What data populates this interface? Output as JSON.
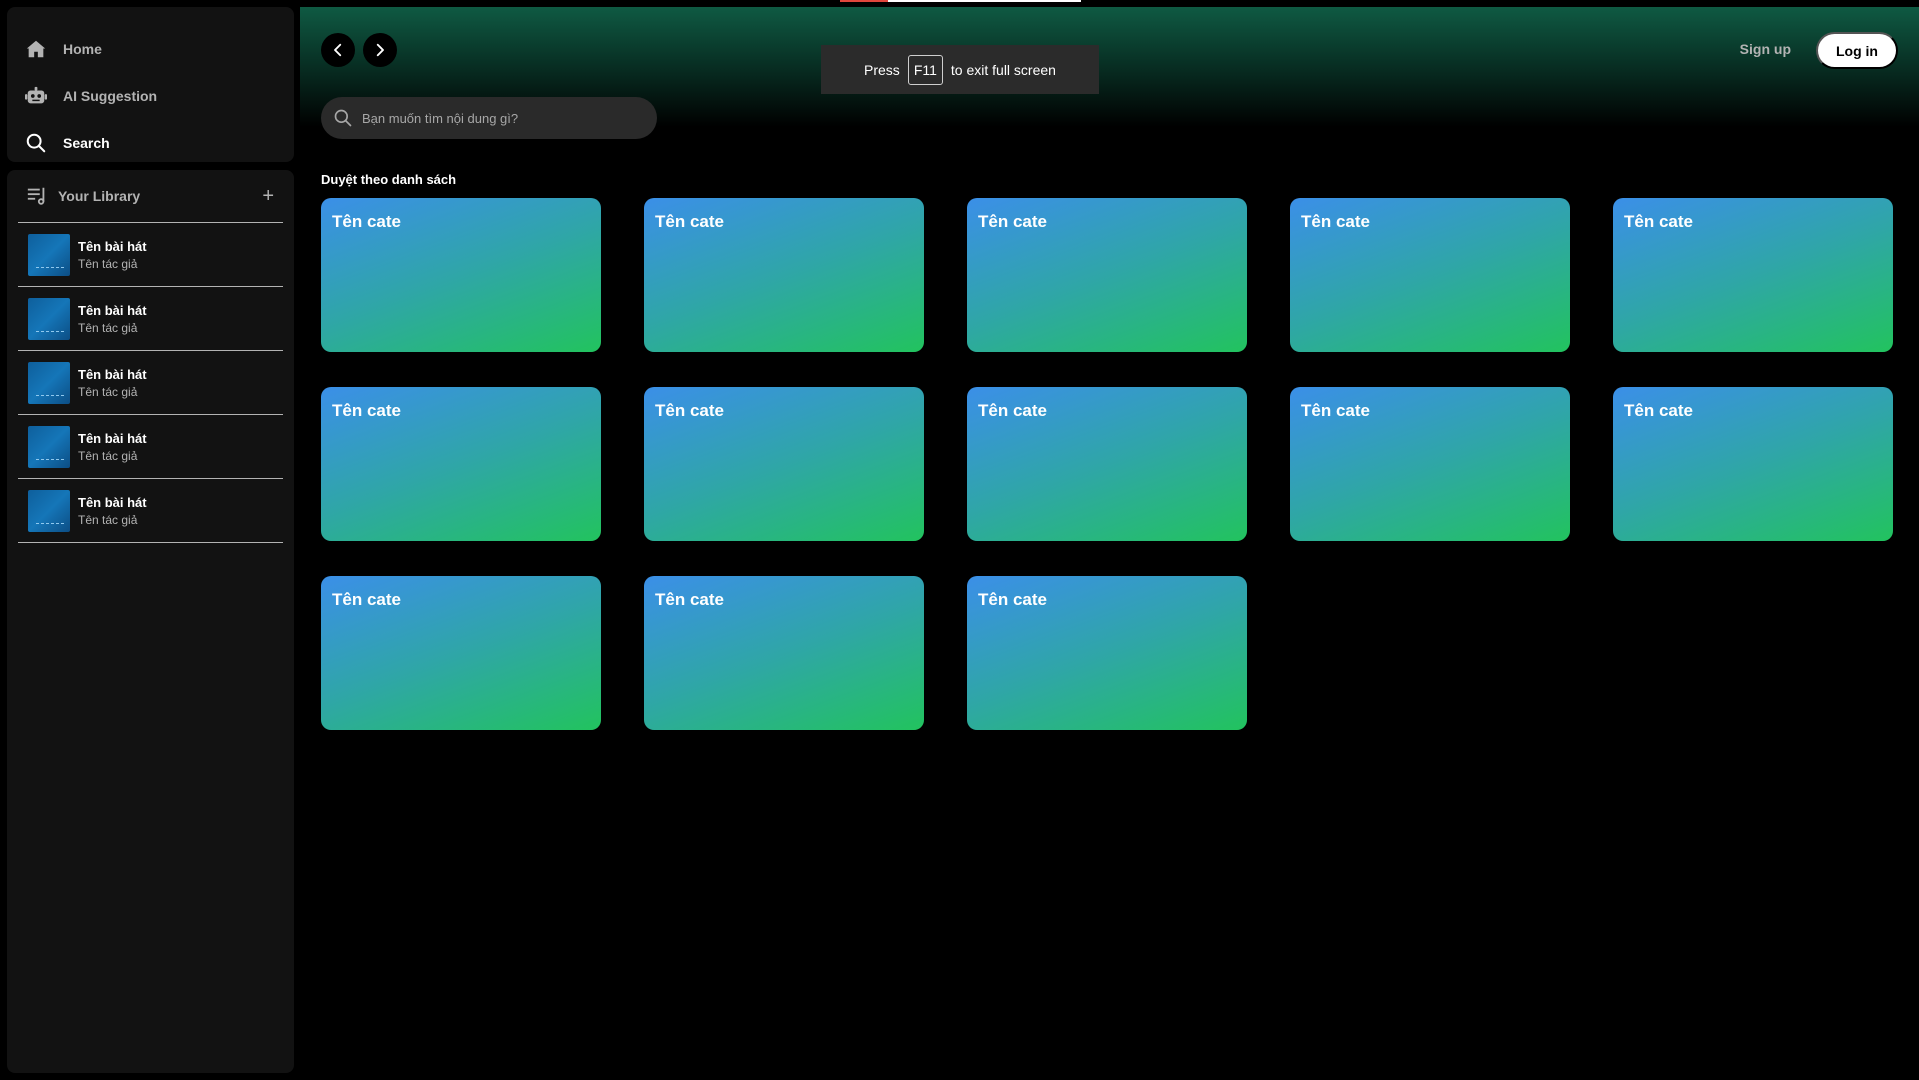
{
  "sidebar": {
    "nav": [
      {
        "label": "Home",
        "icon": "home-icon"
      },
      {
        "label": "AI Suggestion",
        "icon": "robot-icon"
      },
      {
        "label": "Search",
        "icon": "search-icon"
      }
    ],
    "library": {
      "title": "Your Library",
      "add_label": "+",
      "items": [
        {
          "song": "Tên bài hát",
          "artist": "Tên tác giả"
        },
        {
          "song": "Tên bài hát",
          "artist": "Tên tác giả"
        },
        {
          "song": "Tên bài hát",
          "artist": "Tên tác giả"
        },
        {
          "song": "Tên bài hát",
          "artist": "Tên tác giả"
        },
        {
          "song": "Tên bài hát",
          "artist": "Tên tác giả"
        }
      ]
    }
  },
  "header": {
    "signup_label": "Sign up",
    "login_label": "Log in"
  },
  "search": {
    "placeholder": "Bạn muốn tìm nội dung gì?"
  },
  "toast": {
    "prefix": "Press",
    "key": "F11",
    "suffix": "to exit full screen"
  },
  "browse": {
    "title": "Duyệt theo danh sách",
    "categories": [
      "Tên cate",
      "Tên cate",
      "Tên cate",
      "Tên cate",
      "Tên cate",
      "Tên cate",
      "Tên cate",
      "Tên cate",
      "Tên cate",
      "Tên cate",
      "Tên cate",
      "Tên cate",
      "Tên cate"
    ]
  },
  "colors": {
    "card_gradient_start": "#3b8fe8",
    "card_gradient_end": "#22c35e",
    "header_gradient": "#0f5a43",
    "sidebar_bg": "#121212"
  }
}
